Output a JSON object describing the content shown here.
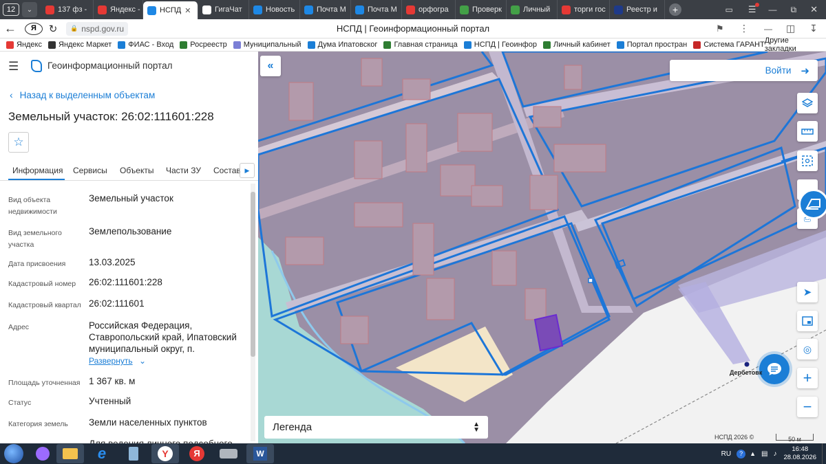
{
  "browser": {
    "tab_count": "12",
    "tabs": [
      {
        "label": "137 фз -",
        "color": "#e53935"
      },
      {
        "label": "Яндекс -",
        "color": "#e53935"
      },
      {
        "label": "НСПД",
        "color": "#1e88e5"
      },
      {
        "label": "ГигаЧат",
        "color": "#ffffff"
      },
      {
        "label": "Новость",
        "color": "#1e88e5"
      },
      {
        "label": "Почта М",
        "color": "#1e88e5"
      },
      {
        "label": "Почта М",
        "color": "#1e88e5"
      },
      {
        "label": "орфогра",
        "color": "#e53935"
      },
      {
        "label": "Проверк",
        "color": "#43a047"
      },
      {
        "label": "Личный",
        "color": "#43a047"
      },
      {
        "label": "торги гос",
        "color": "#e53935"
      },
      {
        "label": "Реестр и",
        "color": "#1e3a8a"
      }
    ],
    "url": "nspd.gov.ru",
    "page_title": "НСПД | Геоинформационный портал",
    "bookmarks": [
      "Яндекс",
      "Яндекс Маркет",
      "ФИАС - Вход",
      "Росреестр",
      "Муниципальный",
      "Дума Ипатовског",
      "Главная страница",
      "НСПД | Геоинфор",
      "Личный кабинет",
      "Портал простран",
      "Система ГАРАНТ"
    ],
    "other_bookmarks": "Другие закладки"
  },
  "portal": {
    "app_title": "Геоинформационный портал",
    "back_link": "Назад к выделенным объектам",
    "object_title": "Земельный участок: 26:02:111601:228",
    "tabs": [
      "Информация",
      "Сервисы",
      "Объекты",
      "Части ЗУ",
      "Состав"
    ],
    "active_tab": "Информация",
    "fields": [
      {
        "label": "Вид объекта недвижимости",
        "value": "Земельный участок"
      },
      {
        "label": "Вид земельного участка",
        "value": "Землепользование"
      },
      {
        "label": "Дата присвоения",
        "value": "13.03.2025"
      },
      {
        "label": "Кадастровый номер",
        "value": "26:02:111601:228"
      },
      {
        "label": "Кадастровый квартал",
        "value": "26:02:111601"
      },
      {
        "label": "Адрес",
        "value": "Российская Федерация, Ставропольский край, Ипатовский муниципальный округ, п."
      },
      {
        "label": "Площадь уточненная",
        "value": "1 367 кв. м"
      },
      {
        "label": "Статус",
        "value": "Учтенный"
      },
      {
        "label": "Категория земель",
        "value": "Земли населенных пунктов"
      }
    ],
    "expand_link": "Развернуть",
    "partial_bottom_text": "Для ведения личного подсобного"
  },
  "map": {
    "login_label": "Войти",
    "legend_label": "Легенда",
    "place_label": "Дербетовк",
    "copyright": "НСПД 2026 ©",
    "scale": "50 м"
  },
  "taskbar": {
    "lang": "RU",
    "time": "16:48",
    "date": "28.08.2026"
  }
}
